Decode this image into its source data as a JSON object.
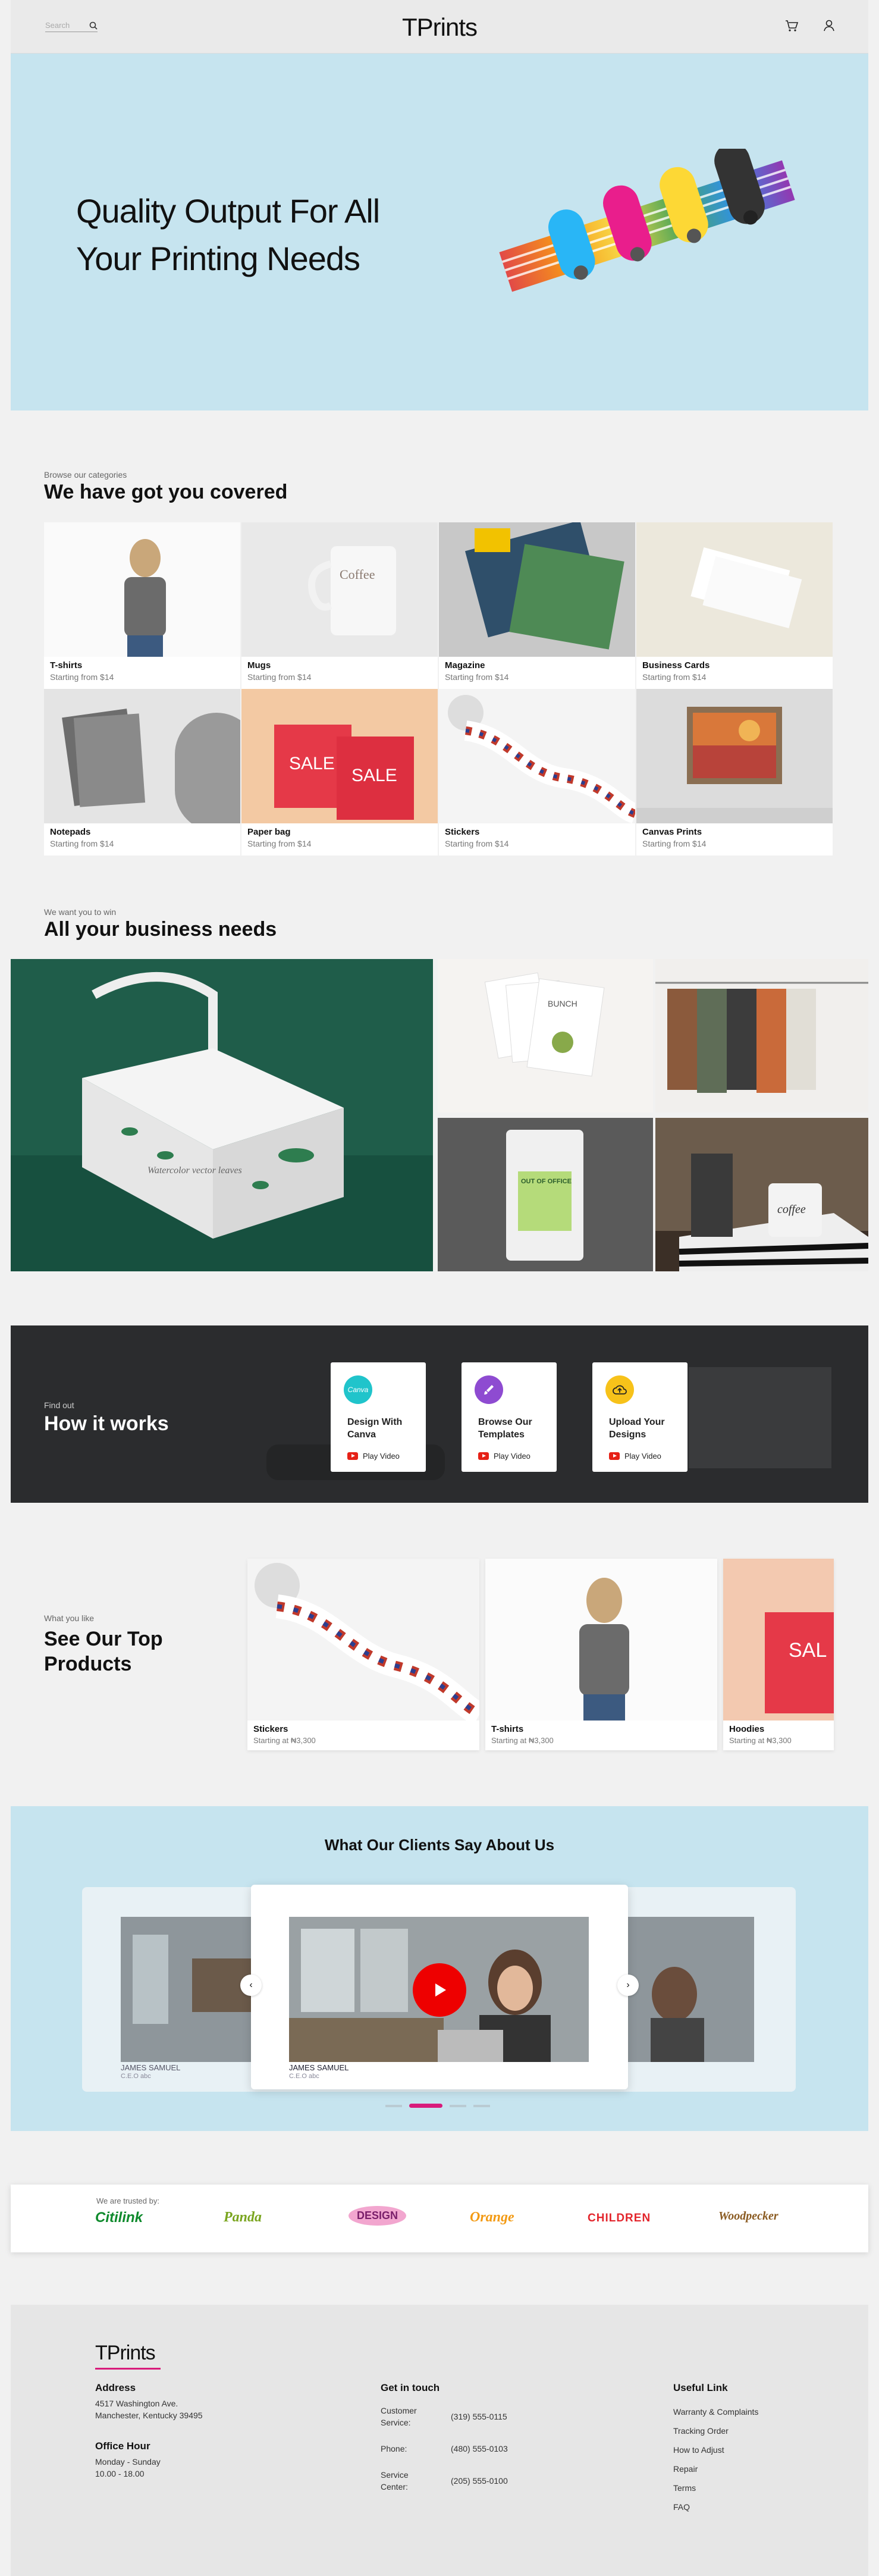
{
  "header": {
    "search_placeholder": "Search",
    "brand": "TPrints"
  },
  "hero": {
    "title_line1": "Quality Output For All",
    "title_line2": "Your Printing Needs"
  },
  "categories": {
    "kicker": "Browse our categories",
    "title": "We have got you covered",
    "items": [
      {
        "name": "T-shirts",
        "price": "Starting from $14"
      },
      {
        "name": "Mugs",
        "price": "Starting from $14"
      },
      {
        "name": "Magazine",
        "price": "Starting from $14"
      },
      {
        "name": "Business Cards",
        "price": "Starting from $14"
      },
      {
        "name": "Notepads",
        "price": "Starting from $14"
      },
      {
        "name": "Paper bag",
        "price": "Starting from $14"
      },
      {
        "name": "Stickers",
        "price": "Starting from $14"
      },
      {
        "name": "Canvas Prints",
        "price": "Starting from $14"
      }
    ],
    "mug_text": "Coffee",
    "sale_text": "SALE"
  },
  "business": {
    "kicker": "We want you to win",
    "title": "All your business needs",
    "bag_text": "Watercolor vector leaves",
    "coffee_bag_text": "OUT OF OFFICE",
    "cards_text": "BUNCH",
    "mug_text": "coffee"
  },
  "how": {
    "kicker": "Find out",
    "title": "How it works",
    "cards": [
      {
        "title": "Design With Canva",
        "action": "Play Video",
        "badge": "Canva"
      },
      {
        "title": "Browse Our Templates",
        "action": "Play Video"
      },
      {
        "title": "Upload Your Designs",
        "action": "Play Video"
      }
    ]
  },
  "products": {
    "kicker": "What you like",
    "title_line1": "See Our Top",
    "title_line2": "Products",
    "items": [
      {
        "name": "Stickers",
        "price": "Starting at ₦3,300"
      },
      {
        "name": "T-shirts",
        "price": "Starting at ₦3,300"
      },
      {
        "name": "Hoodies",
        "price": "Starting at ₦3,300"
      }
    ],
    "sale_text": "SAL"
  },
  "testimonials": {
    "title": "What Our Clients Say About Us",
    "items": [
      {
        "name": "JAMES SAMUEL",
        "role": "C.E.O abc"
      },
      {
        "name": "JAMES SAMUEL",
        "role": "C.E.O abc"
      }
    ]
  },
  "trusted": {
    "label": "We are trusted by:",
    "logos": [
      "Citilink",
      "Panda",
      "DESIGN",
      "Orange",
      "CHILDREN",
      "Woodpecker"
    ]
  },
  "footer": {
    "brand": "TPrints",
    "address_title": "Address",
    "address_line1": "4517 Washington Ave.",
    "address_line2": "Manchester, Kentucky 39495",
    "hours_title": "Office Hour",
    "hours_line1": "Monday - Sunday",
    "hours_line2": "10.00 - 18.00",
    "contact_title": "Get in touch",
    "contacts": [
      {
        "label": "Customer Service:",
        "value": "(319) 555-0115"
      },
      {
        "label": "Phone:",
        "value": "(480) 555-0103"
      },
      {
        "label": "Service Center:",
        "value": "(205) 555-0100"
      }
    ],
    "links_title": "Useful Link",
    "links": [
      "Warranty & Complaints",
      "Tracking Order",
      "How to Adjust",
      "Repair",
      "Terms",
      "FAQ"
    ]
  },
  "colors": {
    "hero_bg": "#c6e4ef",
    "accent": "#d81b7b",
    "dark": "#2a2b2d"
  }
}
